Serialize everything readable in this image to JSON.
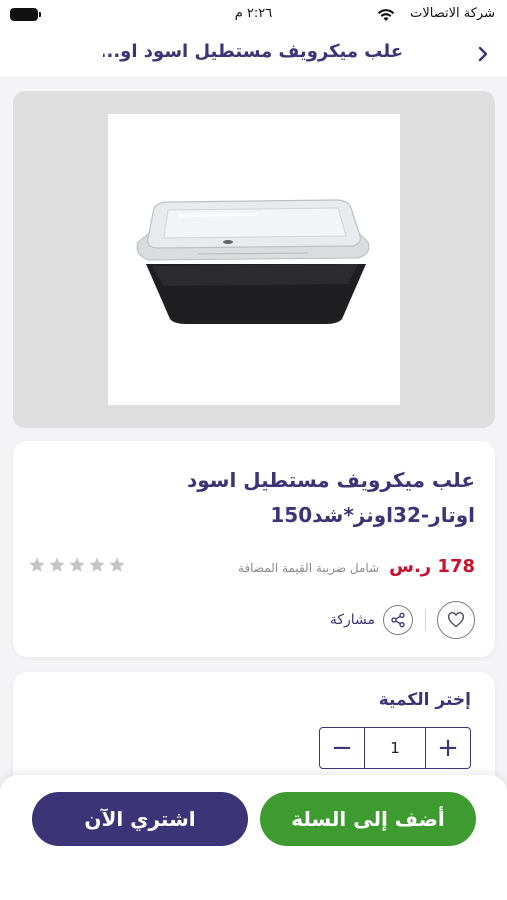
{
  "status_bar": {
    "carrier": "شركة الاتصالات",
    "time": "٢:٢٦ م"
  },
  "header": {
    "title": "علب ميكرويف مستطيل اسود او...",
    "back_icon": "chevron-right-icon"
  },
  "product": {
    "title_line1": "علب ميكرويف مستطيل اسود",
    "title_line2": "اوتار-32اونز*شد150",
    "price": "178 ر.س",
    "vat_note": "شامل ضريبة القيمة المضافة",
    "rating_stars": 0,
    "rating_max": 5,
    "share_label": "مشاركة"
  },
  "quantity": {
    "title": "إختر الكمية",
    "value": "1",
    "minus": "−",
    "plus": "+"
  },
  "actions": {
    "add_to_cart": "أضف إلى السلة",
    "buy_now": "اشتري الآن"
  },
  "colors": {
    "brand_purple": "#3b3476",
    "cart_green": "#3d9b2f",
    "price_red": "#c8102e",
    "star_gray": "#c4c4c8"
  }
}
